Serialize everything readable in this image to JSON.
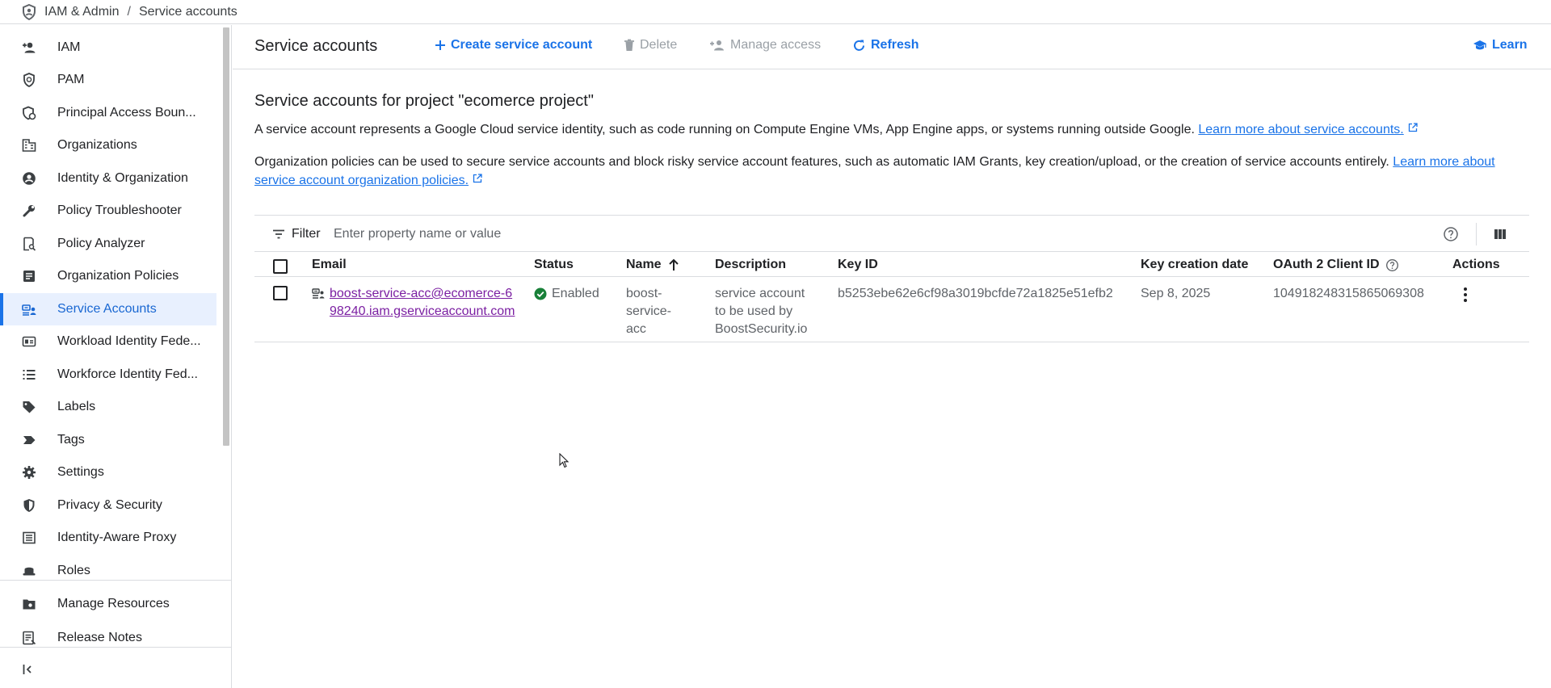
{
  "breadcrumb": {
    "items": [
      "IAM & Admin",
      "Service accounts"
    ],
    "separator": "/"
  },
  "sidebar": {
    "items": [
      {
        "label": "IAM",
        "icon": "person-add-icon"
      },
      {
        "label": "PAM",
        "icon": "shield-clock-icon"
      },
      {
        "label": "Principal Access Boun...",
        "icon": "policy-boundary-icon"
      },
      {
        "label": "Organizations",
        "icon": "domain-icon"
      },
      {
        "label": "Identity & Organization",
        "icon": "account-circle-icon"
      },
      {
        "label": "Policy Troubleshooter",
        "icon": "wrench-icon"
      },
      {
        "label": "Policy Analyzer",
        "icon": "policy-search-icon"
      },
      {
        "label": "Organization Policies",
        "icon": "document-list-icon"
      },
      {
        "label": "Service Accounts",
        "icon": "service-account-icon",
        "active": true
      },
      {
        "label": "Workload Identity Fede...",
        "icon": "badge-icon"
      },
      {
        "label": "Workforce Identity Fed...",
        "icon": "list-icon"
      },
      {
        "label": "Labels",
        "icon": "label-icon"
      },
      {
        "label": "Tags",
        "icon": "tag-icon"
      },
      {
        "label": "Settings",
        "icon": "gear-icon"
      },
      {
        "label": "Privacy & Security",
        "icon": "shield-check-icon"
      },
      {
        "label": "Identity-Aware Proxy",
        "icon": "proxy-icon"
      },
      {
        "label": "Roles",
        "icon": "hat-icon"
      }
    ],
    "footer": [
      {
        "label": "Manage Resources",
        "icon": "folder-gear-icon"
      },
      {
        "label": "Release Notes",
        "icon": "notes-icon"
      }
    ],
    "collapse_icon": "collapse-icon"
  },
  "header": {
    "title": "Service accounts",
    "create_label": "Create service account",
    "delete_label": "Delete",
    "manage_access_label": "Manage access",
    "refresh_label": "Refresh",
    "learn_label": "Learn"
  },
  "content": {
    "heading": "Service accounts for project \"ecomerce project\"",
    "desc1": "A service account represents a Google Cloud service identity, such as code running on Compute Engine VMs, App Engine apps, or systems running outside Google.",
    "desc1_link": "Learn more about service accounts.",
    "desc2": "Organization policies can be used to secure service accounts and block risky service account features, such as automatic IAM Grants, key creation/upload, or the creation of service accounts entirely.",
    "desc2_link": "Learn more about service account organization policies."
  },
  "table": {
    "filter_label": "Filter",
    "filter_placeholder": "Enter property name or value",
    "columns": {
      "email": "Email",
      "status": "Status",
      "name": "Name",
      "description": "Description",
      "key_id": "Key ID",
      "key_creation_date": "Key creation date",
      "oauth_client_id": "OAuth 2 Client ID",
      "actions": "Actions"
    },
    "rows": [
      {
        "email": "boost-service-acc@ecomerce-698240.iam.gserviceaccount.com",
        "status": "Enabled",
        "name": "boost-service-acc",
        "description": "service account to be used by BoostSecurity.io",
        "key_id": "b5253ebe62e6cf98a3019bcfde72a1825e51efb2",
        "key_creation_date": "Sep 8, 2025",
        "oauth_client_id": "104918248315865069308"
      }
    ]
  },
  "colors": {
    "accent": "#1a73e8",
    "active_bg": "#e8f0fe",
    "enabled_green": "#188038",
    "visited_link": "#7b1fa2"
  }
}
